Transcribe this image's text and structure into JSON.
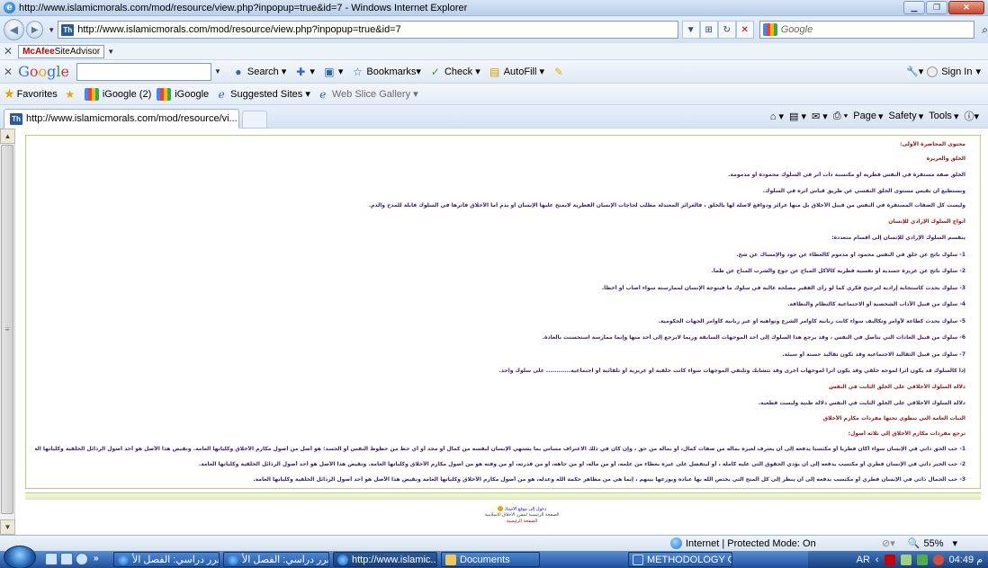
{
  "window": {
    "title": "http://www.islamicmorals.com/mod/resource/view.php?inpopup=true&id=7 - Windows Internet Explorer"
  },
  "address_bar": {
    "url": "http://www.islamicmorals.com/mod/resource/view.php?inpopup=true&id=7",
    "search_placeholder": "Google"
  },
  "mcafee": {
    "label": "SiteAdvisor",
    "brand": "McAfee"
  },
  "google_toolbar": {
    "logo": "Google",
    "search_label": "Search",
    "bookmarks_label": "Bookmarks",
    "check_label": "Check",
    "autofill_label": "AutoFill",
    "signin_label": "Sign In"
  },
  "favorites_bar": {
    "favorites_label": "Favorites",
    "items": [
      "iGoogle (2)",
      "iGoogle",
      "Suggested Sites",
      "Web Slice Gallery"
    ]
  },
  "tabs": {
    "active_label": "http://www.islamicmorals.com/mod/resource/vi...",
    "commands": [
      "Page",
      "Safety",
      "Tools"
    ]
  },
  "content": {
    "lines": [
      "محتوى المحاضرة الأولى:",
      "الخلق والغريزة",
      "الخلق صفة مستقرة في النفس فطرية أو مكتسبة ذات أثر في السلوك محمودة أو مذمومة.",
      "ونستطيع أن نقيس مستوى الخلق النفسي عن طريق قياس أثره في السلوك.",
      "وليست كل الصفات المستقرة في النفس من قبيل الأخلاق بل منها غرائز ودوافع لاصلة لها بالخلق ، فالغرائز المعتدلة مطلب لحاجات الإنسان الفطرية لايمنح عليها الإنسان أو يذم أما الأخلاق فأثرها في السلوك قابلة للمدح والذم.",
      "أنواع السلوك الإرادي للإنسان",
      "ينقسم السلوك الإرادي للإنسان إلى أقسام متعددة:",
      "1- سلوك ناتج عن خلق في النفس محمود أو مذموم كالعطاء عن جود والإمساك عن شح.",
      "2- سلوك ناتج عن غريزة جسدية أو نفسية فطرية كالأكل المباح عن جوع والشرب المباح عن ظمأ.",
      "3- سلوك يحدث كاستجابة إرادية لترجيح فكري كما لو رأى الفقير مصلحة غالبة في سلوك ما فيتوجه الإنسان لممارسته سواء أصاب أو أخطأ.",
      "4- سلوك من قبيل الآداب الشخصية أو الاجتماعية كالنظام والنظافة.",
      "5- سلوك يحدث كطاعة لأوامر وتكاليف سواء كانت ربانية كأوامر الشرع ونواهيه أو غير ربانية كأوامر الجهات الحكومية.",
      "6- سلوك من قبيل العادات التي تتأصل في النفس ، وقد يرجع هذا السلوك إلى أحد الموجهات السابقة وربما لايرجع إلى أحد منها وإنما ممارسة استحسنت بالعادة.",
      "7- سلوك من قبيل التقاليد الاجتماعية وقد تكون تقاليد حسنة أو سيئة.",
      "إذا كالسلوك قد يكون أثرا لموجه خلقي وقد يكون أثرا لموجهات أخرى وقد تتشابك وتلتقي الموجهات سواء كانت خلقية أو غريزية أو تلقائية أو اجتماعية............ على سلوك واحد.",
      "دلالة السلوك الأخلاقي على الخلق الثابت في النفس",
      "دلالة السلوك الأخلاقي على الخلق الثابت في النفس دلالة ظنية وليست قطعية.",
      "النيات العامة التي تنطوي تحتها مفردات مكارم الأخلاق",
      "ترجع مفردات مكارم الأخلاق إلى ثلاثة أصول:",
      "1- حب الحق ذاتي في الإنسان سواء أكان فطريا أو مكتسبا يدفعه إلى أن يعترف لغيره بماله من صفات كمال، أو بماله من حق ، وإن كان في ذلك الاعتراف مساس بما يشتهي الإنسان لنفسه من كمال أو مجد أو أي حظ من حظوظ النفس أو الجسد: هو أصل من أصول مكارم الأخلاق وكلياتها العامة. ونقيض هذا الأصل هو أحد أصول الرذائل الخلقية وكلياتها العامة.",
      "2- حب الخير ذاتي في الإنسان فطري أو مكتسب يدفعه إلى أن يؤدي الحقوق التي عليه كاملة ، أو ليتفضل على غيره بعطاء من علمه، أو من ماله، أو من جاهه، أو من قدرته، أو من وقته هو من أصول مكارم الأخلاق وكلياتها العامة. ونقيض هذا الأصل هو أحد أصول الرذائل الخلقية وكلياتها العامة.",
      "3- حب الجمال ذاتي في الإنسان فطري أو مكتسب يدفعه إلى أن ينظر إلى كل المنح التي يختص الله بها عباده ويوزعها بينهم ، إنما هي من مظاهر حكمة الله وعدله، هو من أصول مكارم الأخلاق وكلياتها العامة ونقيض هذا الأصل هو أحد أصول الرذائل الخلقية وكلياتها العامة."
    ]
  },
  "footer": {
    "line1": "دخول إلى موقع الاستاذ",
    "line2": "الصفحة الرئيسية لمقرر الاخلاق الاسلامية",
    "line3": "الصفحة الرئيسية"
  },
  "status_bar": {
    "zone": "Internet | Protected Mode: On",
    "zoom": "55%"
  },
  "taskbar": {
    "buttons": [
      "مقرر دراسي: الفصل الأ...",
      "مقرر دراسي: الفصل الأ...",
      "http://www.islamic...",
      "Documents",
      "METHODOLOGY C..."
    ],
    "lang": "AR",
    "clock": "04:49 م"
  },
  "colors": {
    "heading": "#9a1414",
    "body_text": "#3a1f6f",
    "content_border": "#b6cf7a"
  }
}
